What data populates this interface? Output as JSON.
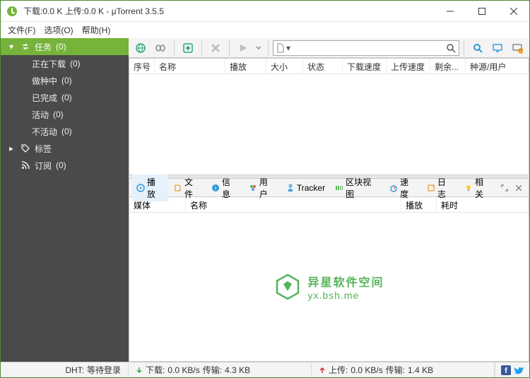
{
  "window": {
    "title": "下载:0.0 K 上传:0.0 K - μTorrent 3.5.5"
  },
  "menubar": {
    "file": "文件(F)",
    "options": "选项(O)",
    "help": "帮助(H)"
  },
  "sidebar": {
    "tasks": {
      "label": "任务",
      "count": "(0)"
    },
    "downloading": {
      "label": "正在下载",
      "count": "(0)"
    },
    "seeding": {
      "label": "做种中",
      "count": "(0)"
    },
    "completed": {
      "label": "已完成",
      "count": "(0)"
    },
    "active": {
      "label": "活动",
      "count": "(0)"
    },
    "inactive": {
      "label": "不活动",
      "count": "(0)"
    },
    "labels": {
      "label": "标签"
    },
    "feeds": {
      "label": "订阅",
      "count": "(0)"
    }
  },
  "columns": {
    "num": "序号",
    "name": "名称",
    "play": "播放",
    "size": "大小",
    "status": "状态",
    "downspeed": "下载速度",
    "upspeed": "上传速度",
    "remain": "剩余...",
    "seeds": "种源/用户"
  },
  "detail_tabs": {
    "play": "播放",
    "files": "文件",
    "info": "信息",
    "peers": "用户",
    "tracker": "Tracker",
    "pieces": "区块视图",
    "speed": "速度",
    "log": "日志",
    "related": "相关"
  },
  "detail_columns": {
    "media": "媒体",
    "name": "名称",
    "play": "播放",
    "duration": "耗时"
  },
  "watermark": {
    "line1": "异星软件空间",
    "line2": "yx.bsh.me"
  },
  "status": {
    "dht_label": "DHT:",
    "dht_value": "等待登录",
    "down_label": "下载:",
    "down_speed": "0.0 KB/s",
    "down_trans_label": "传输:",
    "down_trans": "4.3 KB",
    "up_label": "上传:",
    "up_speed": "0.0 KB/s",
    "up_trans_label": "传输:",
    "up_trans": "1.4 KB"
  }
}
